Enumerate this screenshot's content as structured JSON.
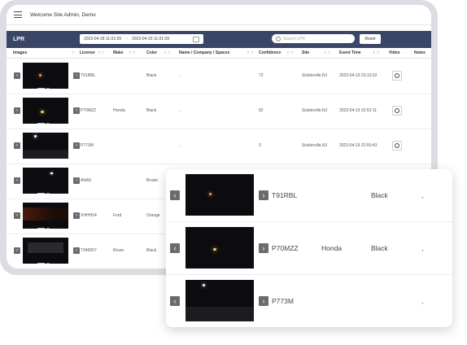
{
  "header": {
    "welcome": "Welcome Site Admin, Demo"
  },
  "toolbar": {
    "title": "LPR",
    "date_from": "2023-04-18 11:01:09",
    "date_sep": "~",
    "date_to": "2023-04-20 11:01:09",
    "search_placeholder": "Search LPR",
    "reset_label": "Reset"
  },
  "columns": [
    "Images",
    "License",
    "Make",
    "Color",
    "Name / Company / Spaces",
    "Confidence",
    "Site",
    "Event Time",
    "Video",
    "Notes"
  ],
  "rows": [
    {
      "license": "T91RBL",
      "make": "",
      "color": "Black",
      "name": ",",
      "confidence": "72",
      "site": "Sicklerville,NJ",
      "time": "2023-04-19 23:10:22",
      "video": true
    },
    {
      "license": "P70MZZ",
      "make": "Honda",
      "color": "Black",
      "name": ",",
      "confidence": "92",
      "site": "Sicklerville,NJ",
      "time": "2023-04-19 22:52:11",
      "video": true
    },
    {
      "license": "P773M",
      "make": "",
      "color": "",
      "name": ",",
      "confidence": "0",
      "site": "Sicklerville,NJ",
      "time": "2023-04-19 22:50:43",
      "video": true
    },
    {
      "license": "ANA3",
      "make": "",
      "color": "Brown",
      "name": "",
      "confidence": "",
      "site": "",
      "time": "",
      "video": false
    },
    {
      "license": "XHHH24",
      "make": "Ford",
      "color": "Orange",
      "name": "",
      "confidence": "",
      "site": "",
      "time": "",
      "video": false
    },
    {
      "license": "T340057",
      "make": "Rover",
      "color": "Black",
      "name": "",
      "confidence": "",
      "site": "",
      "time": "",
      "video": false
    }
  ],
  "zoom_rows": [
    {
      "license": "T91RBL",
      "make": "",
      "color": "Black",
      "name": ","
    },
    {
      "license": "P70MZZ",
      "make": "Honda",
      "color": "Black",
      "name": ","
    },
    {
      "license": "P773M",
      "make": "",
      "color": "",
      "name": ","
    }
  ],
  "icons": {
    "menu": "hamburger-icon",
    "prev": "chevron-left-icon",
    "next": "chevron-right-icon",
    "video": "play-icon",
    "search": "search-icon",
    "calendar": "calendar-icon"
  }
}
